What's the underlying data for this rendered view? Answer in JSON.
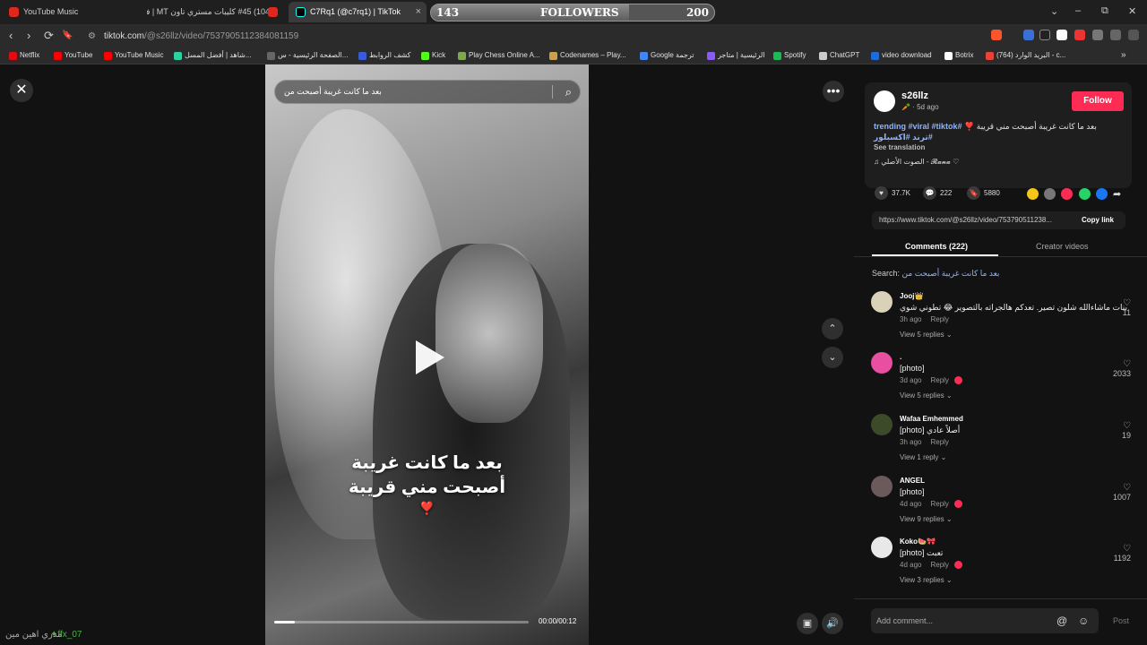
{
  "tabs": [
    {
      "title": "YouTube Music"
    },
    {
      "title": "(104) #45 كليبات مستري تاون MT | فـ"
    },
    {
      "title": "C7Rq1 (@c7rq1) | TikTok",
      "close": "×"
    }
  ],
  "followers_widget": {
    "start": "143",
    "label": "FOLLOWERS",
    "end": "200",
    "progress": 0.7
  },
  "window_controls": {
    "chevron": "⌄",
    "minimize": "–",
    "restore": "⧉",
    "close": "✕"
  },
  "toolbar": {
    "back": "‹",
    "forward": "›",
    "reload": "⟳",
    "bookmark": "🔖",
    "url_host": "tiktok.com",
    "url_path": "/@s26llz/video/7537905112384081159"
  },
  "bookmarks": [
    {
      "label": "Netflix",
      "color": "#e50914"
    },
    {
      "label": "YouTube",
      "color": "#ff0000"
    },
    {
      "label": "YouTube Music",
      "color": "#ff0000"
    },
    {
      "label": "شاهد | أفضل المسل...",
      "color": "#2bd1a0"
    },
    {
      "label": "الصفحة الرئيسية - س...",
      "color": "#666"
    },
    {
      "label": "كشف الروابط",
      "color": "#3a5bd9"
    },
    {
      "label": "Kick",
      "color": "#53fc18"
    },
    {
      "label": "Play Chess Online A...",
      "color": "#7fa650"
    },
    {
      "label": "Codenames – Play...",
      "color": "#c9a24b"
    },
    {
      "label": "Google ترجمة",
      "color": "#4285f4"
    },
    {
      "label": "الرئيسية | متاجر",
      "color": "#8a5cf6"
    },
    {
      "label": "Spotify",
      "color": "#1db954"
    },
    {
      "label": "ChatGPT",
      "color": "#cccccc"
    },
    {
      "label": "video download",
      "color": "#1e6cd9"
    },
    {
      "label": "Botrix",
      "color": "#ffffff"
    },
    {
      "label": "(764) البريد الوارد - c...",
      "color": "#ea4335"
    }
  ],
  "bookmarks_more": "»",
  "video": {
    "search_text": "بعد ما كانت غريبة أصبحت من",
    "caption_line1": "بعد ما كانت غريبة",
    "caption_line2": "أصبحت مني قريبة",
    "caption_emoji": "❣️",
    "time": "00:00/00:12",
    "progress": 0.08,
    "close": "✕",
    "more": "•••",
    "up": "⌃",
    "down": "⌄",
    "pip": "▣",
    "volume": "🔊",
    "search_glyph": "⌕"
  },
  "overlay": {
    "handle": "✦ffx_07",
    "text": "مدري اهين مين"
  },
  "author": {
    "name": "s26llz",
    "meta": "🥕 · 5d ago",
    "follow": "Follow"
  },
  "description": {
    "text": "بعد ما كانت غريبة أصبحت مني قريبة ❣️",
    "tags": "#trending #viral #tiktok #ترند #اكسبلور",
    "see_translation": "See translation",
    "sound": "♫  الصوت الأصلي - 𝓡𝓪𝓷𝓪 ♡"
  },
  "stats": {
    "likes": "37.7K",
    "comments": "222",
    "saves": "5880",
    "like_icon": "♥",
    "comment_icon": "💬",
    "save_icon": "🔖"
  },
  "share_colors": [
    "#f5c518",
    "#777777",
    "#fe2c55",
    "#25d366",
    "#1877f2"
  ],
  "share_arrow": "➦",
  "link": {
    "url": "https://www.tiktok.com/@s26llz/video/753790511238...",
    "copy": "Copy link"
  },
  "panel_tabs": [
    {
      "label": "Comments (222)"
    },
    {
      "label": "Creator videos"
    }
  ],
  "search_related": {
    "prefix": "Search: ",
    "query": "بعد ما كانت غريبة أصبحت من"
  },
  "comments": [
    {
      "name": "Jooj👑",
      "text": "بنات ماشاءالله شلون تصير. تعدكم هالجراته بالتصوير 😂 تطوني شوي",
      "time": "3h ago",
      "reply": "Reply",
      "view": "View 5 replies ⌄",
      "likes": "11",
      "avatar": "#d9d2b8",
      "creator_liked": false
    },
    {
      "name": ".",
      "text": "[photo]",
      "time": "3d ago",
      "reply": "Reply",
      "view": "View 5 replies ⌄",
      "likes": "2033",
      "avatar": "#e84fa0",
      "creator_liked": true
    },
    {
      "name": "Wafaa Emhemmed",
      "text": "[photo] أصلاً عادي",
      "time": "3h ago",
      "reply": "Reply",
      "view": "View 1 reply ⌄",
      "likes": "19",
      "avatar": "#3d4a2a",
      "creator_liked": false
    },
    {
      "name": "ANGEL",
      "text": "[photo]",
      "time": "4d ago",
      "reply": "Reply",
      "view": "View 9 replies ⌄",
      "likes": "1007",
      "avatar": "#6b5a5a",
      "creator_liked": true
    },
    {
      "name": "Koko🍉🎀",
      "text": "[photo] تعبت",
      "time": "4d ago",
      "reply": "Reply",
      "view": "View 3 replies ⌄",
      "likes": "1192",
      "avatar": "#e8e8e8",
      "creator_liked": true
    }
  ],
  "comment_like_icon": "♡",
  "add_comment": {
    "placeholder": "Add comment...",
    "post": "Post",
    "mention": "@",
    "emoji": "☺"
  }
}
